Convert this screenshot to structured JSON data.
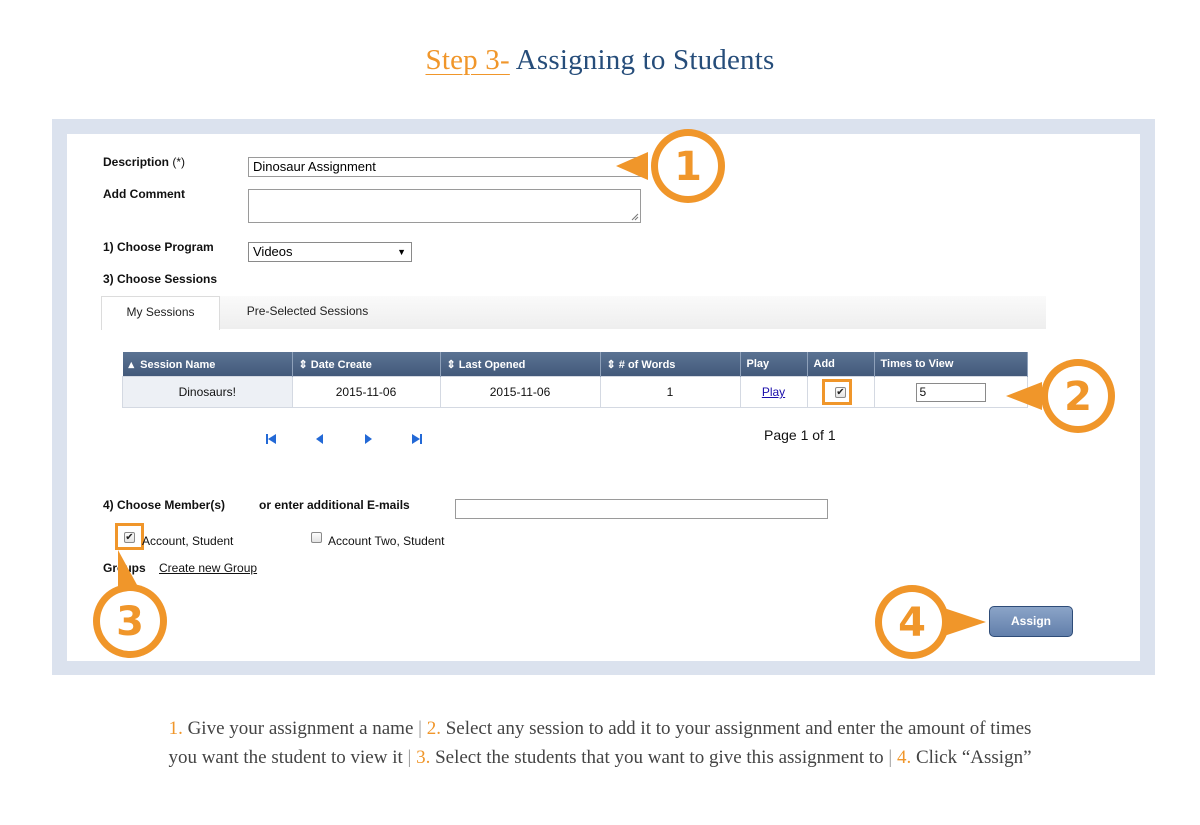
{
  "title": {
    "step": "Step 3-",
    "text": " Assigning to Students"
  },
  "form": {
    "description_label": "Description",
    "description_required": "(*)",
    "description_value": "Dinosaur Assignment",
    "comment_label": "Add Comment",
    "comment_value": "",
    "program_label": "1) Choose Program",
    "program_value": "Videos",
    "sessions_label": "3) Choose Sessions",
    "members_label": "4) Choose Member(s)",
    "emails_label": "or enter additional E-mails",
    "emails_value": "",
    "groups_label": "Groups",
    "create_group_link": "Create new Group"
  },
  "tabs": [
    {
      "label": "My Sessions",
      "active": true
    },
    {
      "label": "Pre-Selected Sessions",
      "active": false
    }
  ],
  "table": {
    "headers": [
      "Session Name",
      "Date Create",
      "Last Opened",
      "# of Words",
      "Play",
      "Add",
      "Times to View"
    ],
    "rows": [
      {
        "name": "Dinosaurs!",
        "date_create": "2015-11-06",
        "last_opened": "2015-11-06",
        "words": "1",
        "play": "Play",
        "add_checked": true,
        "times": "5"
      }
    ]
  },
  "pager": {
    "text": "Page 1 of 1"
  },
  "members": [
    {
      "name": "Account, Student",
      "checked": true
    },
    {
      "name": "Account Two, Student",
      "checked": false
    }
  ],
  "assign_button": "Assign",
  "callouts": [
    "1",
    "2",
    "3",
    "4"
  ],
  "instructions": {
    "n1": "1.",
    "t1": " Give your assignment a name ",
    "n2": "2.",
    "t2": " Select any session to add it to your assignment and enter the amount of times",
    "t2b": "you want the student to view it ",
    "n3": "3.",
    "t3": " Select the students that you want to give this assignment to ",
    "n4": "4.",
    "t4": " Click “Assign”",
    "sep": "|"
  },
  "colors": {
    "accent": "#f0962a",
    "title_blue": "#264d7a",
    "header_blue": "#4c6386",
    "frame": "#dbe2ee"
  }
}
